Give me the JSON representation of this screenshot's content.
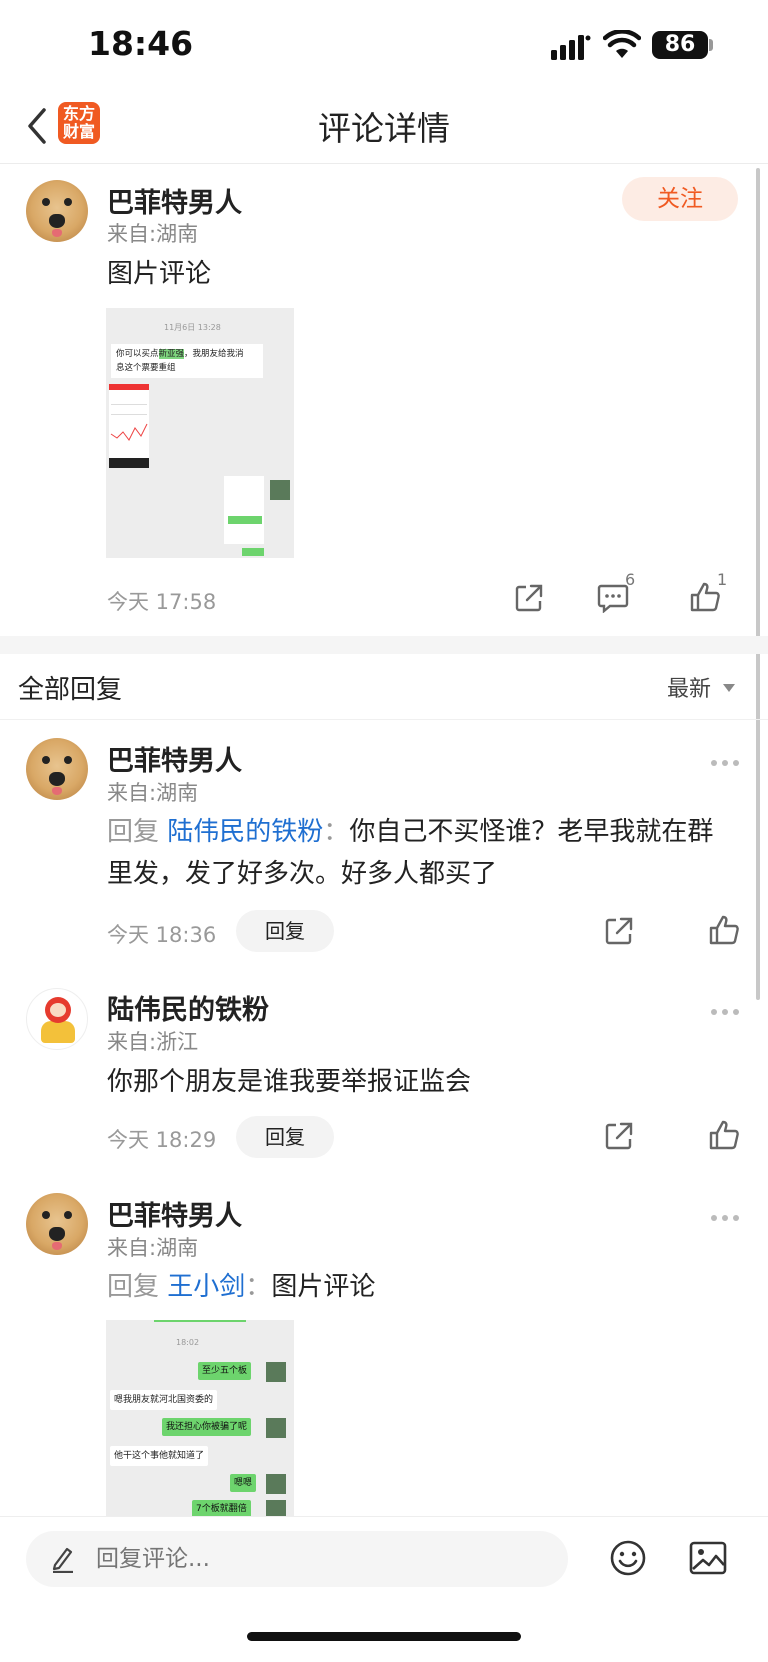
{
  "status": {
    "time": "18:46",
    "battery": "86"
  },
  "nav": {
    "logo": "东方\n财富",
    "title": "评论详情"
  },
  "post": {
    "username": "巴菲特男人",
    "from": "来自:湖南",
    "text": "图片评论",
    "follow": "关注",
    "time": "今天 17:58",
    "comment_count": "6",
    "like_count": "1",
    "image": {
      "date": "11月6日 13:28",
      "msg1_pre": "你可以买点",
      "msg1_highlight": "新亚强",
      "msg1_post": "，我朋友给我消",
      "msg1_line2": "息这个票要重组"
    }
  },
  "section": {
    "title": "全部回复",
    "sort": "最新"
  },
  "replies": [
    {
      "username": "巴菲特男人",
      "from": "来自:湖南",
      "prefix": "回复",
      "target": "陆伟民的铁粉",
      "colon": "：",
      "text": "你自己不买怪谁？老早我就在群里发，发了好多次。好多人都买了",
      "time": "今天 18:36",
      "reply_btn": "回复"
    },
    {
      "username": "陆伟民的铁粉",
      "from": "来自:浙江",
      "text": "你那个朋友是谁我要举报证监会",
      "time": "今天 18:29",
      "reply_btn": "回复"
    },
    {
      "username": "巴菲特男人",
      "from": "来自:湖南",
      "prefix": "回复",
      "target": "王小剑",
      "colon": "：",
      "text": "图片评论",
      "image": {
        "date": "18:02",
        "m1": "至少五个板",
        "m2": "嗯我朋友就河北国资委的",
        "m3": "我还担心你被骗了呢",
        "m4": "他干这个事他就知道了",
        "m5": "嗯嗯",
        "m6": "7个板就翻倍"
      }
    }
  ],
  "bottom": {
    "placeholder": "回复评论..."
  }
}
